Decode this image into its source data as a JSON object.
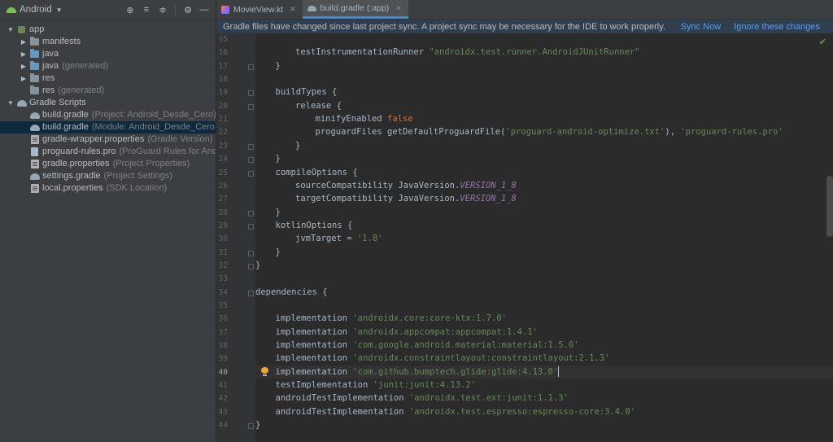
{
  "sidebar": {
    "title": "Android",
    "tree": [
      {
        "label": "app",
        "hint": "",
        "depth": 0,
        "arrow": "down",
        "icon": "module",
        "selected": false,
        "dim": false
      },
      {
        "label": "manifests",
        "hint": "",
        "depth": 1,
        "arrow": "right",
        "icon": "folder",
        "selected": false,
        "dim": false
      },
      {
        "label": "java",
        "hint": "",
        "depth": 1,
        "arrow": "right",
        "icon": "folder-blue",
        "selected": false,
        "dim": false
      },
      {
        "label": "java",
        "hint": "(generated)",
        "depth": 1,
        "arrow": "right",
        "icon": "folder-blue",
        "selected": false,
        "dim": false
      },
      {
        "label": "res",
        "hint": "",
        "depth": 1,
        "arrow": "right",
        "icon": "folder",
        "selected": false,
        "dim": false
      },
      {
        "label": "res",
        "hint": "(generated)",
        "depth": 1,
        "arrow": "none",
        "icon": "folder",
        "selected": false,
        "dim": false
      },
      {
        "label": "Gradle Scripts",
        "hint": "",
        "depth": 0,
        "arrow": "down",
        "icon": "gradle",
        "selected": false,
        "dim": false
      },
      {
        "label": "build.gradle",
        "hint": "(Project: Android_Desde_Cero)",
        "depth": 1,
        "arrow": "none",
        "icon": "gradle",
        "selected": false,
        "dim": false
      },
      {
        "label": "build.gradle",
        "hint": "(Module: Android_Desde_Cero.app)",
        "depth": 1,
        "arrow": "none",
        "icon": "gradle",
        "selected": true,
        "dim": false
      },
      {
        "label": "gradle-wrapper.properties",
        "hint": "(Gradle Version)",
        "depth": 1,
        "arrow": "none",
        "icon": "props",
        "selected": false,
        "dim": false
      },
      {
        "label": "proguard-rules.pro",
        "hint": "(ProGuard Rules for Android_Desde_Cero.app)",
        "depth": 1,
        "arrow": "none",
        "icon": "file",
        "selected": false,
        "dim": false
      },
      {
        "label": "gradle.properties",
        "hint": "(Project Properties)",
        "depth": 1,
        "arrow": "none",
        "icon": "props",
        "selected": false,
        "dim": false
      },
      {
        "label": "settings.gradle",
        "hint": "(Project Settings)",
        "depth": 1,
        "arrow": "none",
        "icon": "gradle",
        "selected": false,
        "dim": false
      },
      {
        "label": "local.properties",
        "hint": "(SDK Location)",
        "depth": 1,
        "arrow": "none",
        "icon": "props",
        "selected": false,
        "dim": false
      }
    ]
  },
  "tabs": [
    {
      "label": "MovieView.kt",
      "icon": "kotlin",
      "active": false
    },
    {
      "label": "build.gradle (:app)",
      "icon": "gradle",
      "active": true
    }
  ],
  "banner": {
    "message": "Gradle files have changed since last project sync. A project sync may be necessary for the IDE to work properly.",
    "sync": "Sync Now",
    "ignore": "Ignore these changes"
  },
  "editor": {
    "current_line": "40",
    "lines": [
      {
        "n": "15",
        "indent": 0,
        "fold": false,
        "tokens": []
      },
      {
        "n": "16",
        "indent": 2,
        "fold": false,
        "tokens": [
          {
            "t": "testInstrumentationRunner ",
            "c": ""
          },
          {
            "t": "\"androidx.test.runner.AndroidJUnitRunner\"",
            "c": "s"
          }
        ]
      },
      {
        "n": "17",
        "indent": 1,
        "fold": true,
        "tokens": [
          {
            "t": "}",
            "c": ""
          }
        ]
      },
      {
        "n": "18",
        "indent": 0,
        "fold": false,
        "tokens": []
      },
      {
        "n": "19",
        "indent": 1,
        "fold": true,
        "tokens": [
          {
            "t": "buildTypes {",
            "c": ""
          }
        ]
      },
      {
        "n": "20",
        "indent": 2,
        "fold": true,
        "tokens": [
          {
            "t": "release {",
            "c": ""
          }
        ]
      },
      {
        "n": "21",
        "indent": 3,
        "fold": false,
        "tokens": [
          {
            "t": "minifyEnabled ",
            "c": ""
          },
          {
            "t": "false",
            "c": "k"
          }
        ]
      },
      {
        "n": "22",
        "indent": 3,
        "fold": false,
        "tokens": [
          {
            "t": "proguardFiles getDefaultProguardFile(",
            "c": ""
          },
          {
            "t": "'proguard-android-optimize.txt'",
            "c": "s"
          },
          {
            "t": "), ",
            "c": ""
          },
          {
            "t": "'proguard-rules.pro'",
            "c": "s"
          }
        ]
      },
      {
        "n": "23",
        "indent": 2,
        "fold": true,
        "tokens": [
          {
            "t": "}",
            "c": ""
          }
        ]
      },
      {
        "n": "24",
        "indent": 1,
        "fold": true,
        "tokens": [
          {
            "t": "}",
            "c": ""
          }
        ]
      },
      {
        "n": "25",
        "indent": 1,
        "fold": true,
        "tokens": [
          {
            "t": "compileOptions {",
            "c": ""
          }
        ]
      },
      {
        "n": "26",
        "indent": 2,
        "fold": false,
        "tokens": [
          {
            "t": "sourceCompatibility JavaVersion.",
            "c": ""
          },
          {
            "t": "VERSION_1_8",
            "c": "c"
          }
        ]
      },
      {
        "n": "27",
        "indent": 2,
        "fold": false,
        "tokens": [
          {
            "t": "targetCompatibility JavaVersion.",
            "c": ""
          },
          {
            "t": "VERSION_1_8",
            "c": "c"
          }
        ]
      },
      {
        "n": "28",
        "indent": 1,
        "fold": true,
        "tokens": [
          {
            "t": "}",
            "c": ""
          }
        ]
      },
      {
        "n": "29",
        "indent": 1,
        "fold": true,
        "tokens": [
          {
            "t": "kotlinOptions {",
            "c": ""
          }
        ]
      },
      {
        "n": "30",
        "indent": 2,
        "fold": false,
        "tokens": [
          {
            "t": "jvmTarget = ",
            "c": ""
          },
          {
            "t": "'1.8'",
            "c": "s"
          }
        ]
      },
      {
        "n": "31",
        "indent": 1,
        "fold": true,
        "tokens": [
          {
            "t": "}",
            "c": ""
          }
        ]
      },
      {
        "n": "32",
        "indent": 0,
        "fold": true,
        "tokens": [
          {
            "t": "}",
            "c": ""
          }
        ]
      },
      {
        "n": "33",
        "indent": 0,
        "fold": false,
        "tokens": []
      },
      {
        "n": "34",
        "indent": 0,
        "fold": true,
        "tokens": [
          {
            "t": "dependencies {",
            "c": ""
          }
        ]
      },
      {
        "n": "35",
        "indent": 0,
        "fold": false,
        "tokens": []
      },
      {
        "n": "36",
        "indent": 1,
        "fold": false,
        "tokens": [
          {
            "t": "implementation ",
            "c": ""
          },
          {
            "t": "'androidx.core:core-ktx:1.7.0'",
            "c": "s"
          }
        ]
      },
      {
        "n": "37",
        "indent": 1,
        "fold": false,
        "tokens": [
          {
            "t": "implementation ",
            "c": ""
          },
          {
            "t": "'androidx.appcompat:appcompat:1.4.1'",
            "c": "s"
          }
        ]
      },
      {
        "n": "38",
        "indent": 1,
        "fold": false,
        "tokens": [
          {
            "t": "implementation ",
            "c": ""
          },
          {
            "t": "'com.google.android.material:material:1.5.0'",
            "c": "s"
          }
        ]
      },
      {
        "n": "39",
        "indent": 1,
        "fold": false,
        "tokens": [
          {
            "t": "implementation ",
            "c": ""
          },
          {
            "t": "'androidx.constraintlayout:constraintlayout:2.1.3'",
            "c": "s"
          }
        ]
      },
      {
        "n": "40",
        "indent": 1,
        "fold": false,
        "tokens": [
          {
            "t": "implementation ",
            "c": ""
          },
          {
            "t": "'com.github.bumptech.glide:glide:4.13.0'",
            "c": "s"
          }
        ]
      },
      {
        "n": "41",
        "indent": 1,
        "fold": false,
        "tokens": [
          {
            "t": "testImplementation ",
            "c": ""
          },
          {
            "t": "'junit:junit:4.13.2'",
            "c": "s"
          }
        ]
      },
      {
        "n": "42",
        "indent": 1,
        "fold": false,
        "tokens": [
          {
            "t": "androidTestImplementation ",
            "c": ""
          },
          {
            "t": "'androidx.test.ext:junit:1.1.3'",
            "c": "s"
          }
        ]
      },
      {
        "n": "43",
        "indent": 1,
        "fold": false,
        "tokens": [
          {
            "t": "androidTestImplementation ",
            "c": ""
          },
          {
            "t": "'androidx.test.espresso:espresso-core:3.4.0'",
            "c": "s"
          }
        ]
      },
      {
        "n": "44",
        "indent": 0,
        "fold": true,
        "tokens": [
          {
            "t": "}",
            "c": ""
          }
        ]
      }
    ]
  }
}
